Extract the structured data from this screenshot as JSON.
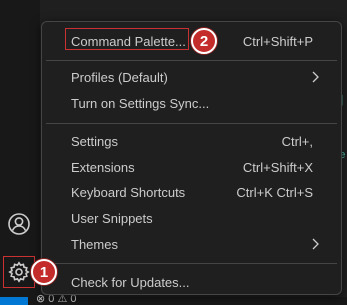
{
  "theme": {
    "menu_bg": "#1f1f1f",
    "border": "#454545",
    "text": "#cccccc",
    "highlight": "#c93232",
    "badge_bg": "#c42b2b",
    "accent": "#0078d4"
  },
  "activity_bar": {
    "accounts_icon": "person-icon",
    "manage_icon": "gear-icon"
  },
  "status_bar": {
    "text": "⊗ 0 ⚠ 0"
  },
  "menu": {
    "command_palette": {
      "label": "Command Palette...",
      "shortcut": "Ctrl+Shift+P"
    },
    "profiles": {
      "label": "Profiles (Default)"
    },
    "settings_sync": {
      "label": "Turn on Settings Sync..."
    },
    "settings": {
      "label": "Settings",
      "shortcut": "Ctrl+,"
    },
    "extensions": {
      "label": "Extensions",
      "shortcut": "Ctrl+Shift+X"
    },
    "keyboard_shortcuts": {
      "label": "Keyboard Shortcuts",
      "shortcut": "Ctrl+K Ctrl+S"
    },
    "user_snippets": {
      "label": "User Snippets"
    },
    "themes": {
      "label": "Themes"
    },
    "check_updates": {
      "label": "Check for Updates..."
    }
  },
  "annotations": {
    "badge_1": "1",
    "badge_2": "2"
  }
}
